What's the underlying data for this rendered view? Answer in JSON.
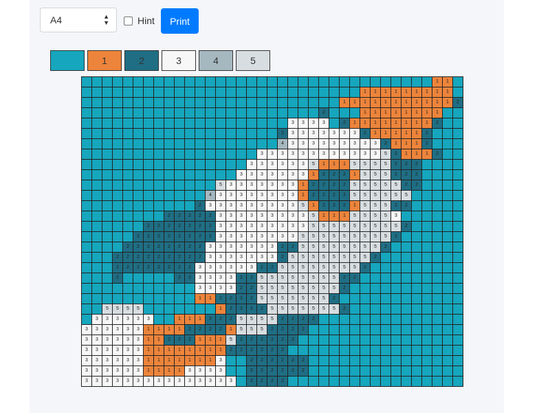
{
  "toolbar": {
    "paper_size": "A4",
    "hint_label": "Hint",
    "print_label": "Print"
  },
  "palette": [
    {
      "label": "",
      "color": "#16a6bd"
    },
    {
      "label": "1",
      "color": "#ed843b"
    },
    {
      "label": "2",
      "color": "#1f6e84"
    },
    {
      "label": "3",
      "color": "#f7f7f7"
    },
    {
      "label": "4",
      "color": "#a5b8c0"
    },
    {
      "label": "5",
      "color": "#d7dde0"
    }
  ],
  "grid": {
    "rows": [
      "0000000000000000000000000000000000110",
      "0000000000000000000000000001111111110",
      "0000000000000000000000000111111111112",
      "0000000000000000000000020001111111100",
      "0000000000000000000033330211111111200",
      "0000000000000000000233333332111112000",
      "0000000000000000000433333333321112000",
      "0000000000000000033333333333352111200",
      "0000000000000000333333511155552220000",
      "0000000000000003333333122215552220000",
      "0000000000000533333331222255555220000",
      "0000000000004333333331222255555500000",
      "0000000000023333333335122215552200000",
      "0000000022222333333333511155553000000",
      "0000002222222333333333555555555200000",
      "0000022222222333333335555555552000000",
      "0000222222223333333225555555520000000",
      "0002222222223333333255555555200000000",
      "0002222222233333322555555552000000000",
      "0002000002233332255555555220000000000",
      "0000000000033332255555555200000000000",
      "0000000000011222255555552000000000000",
      "0055550000000122225555555200000000000",
      "0333333001112225555222200000000000000",
      "3333331111222215552222000000000000000",
      "3333331122211152222220000000000000000",
      "3333331111111122222200000000000000000",
      "3333331111111300222222000000000000000",
      "3333331111333300222222000000000000000",
      "3333333333333330222200000000000000000"
    ]
  }
}
